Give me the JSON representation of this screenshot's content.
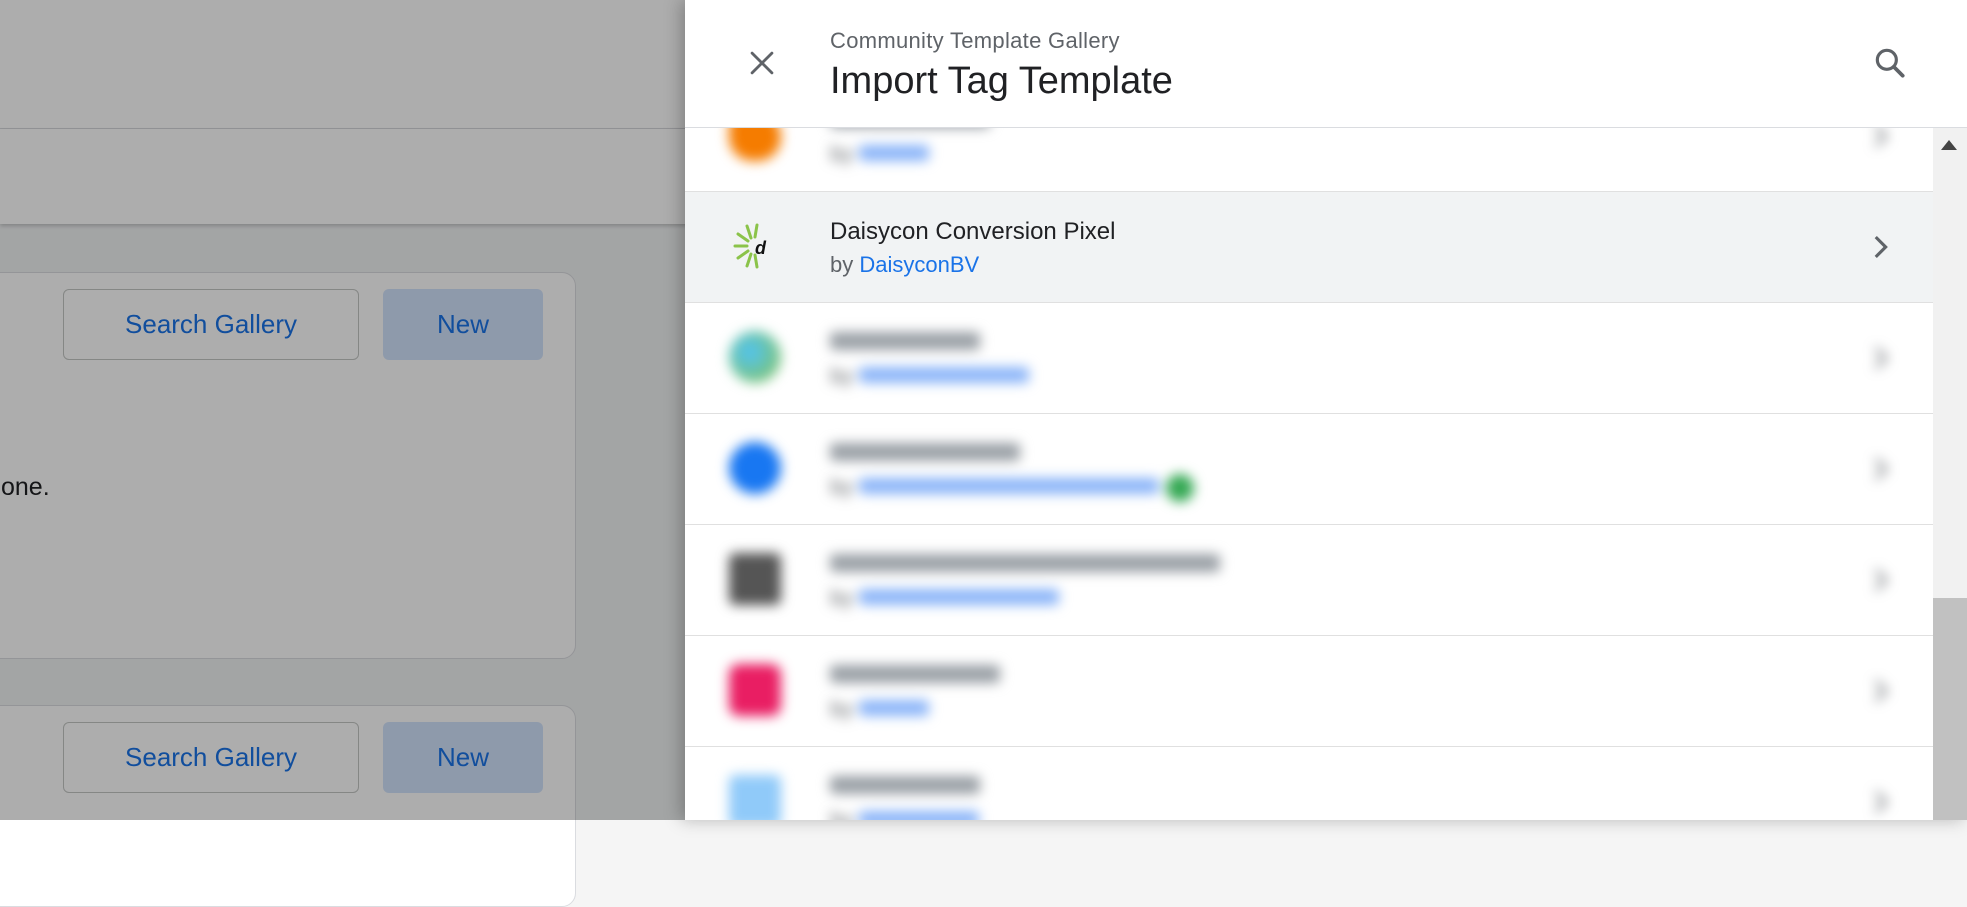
{
  "background": {
    "search_gallery_label": "Search Gallery",
    "new_label": "New",
    "description_fragment": "one."
  },
  "drawer": {
    "kicker": "Community Template Gallery",
    "title": "Import Tag Template",
    "close_icon": "close-icon",
    "search_icon": "search-icon"
  },
  "list": {
    "by_prefix": "by",
    "items": [
      {
        "name": "",
        "publisher": "",
        "logo_color": "#f57c00",
        "blurred": true
      },
      {
        "name": "Daisycon Conversion Pixel",
        "publisher": "DaisyconBV",
        "logo": "daisycon-logo",
        "blurred": false,
        "selected": true
      },
      {
        "name": "",
        "publisher": "",
        "logo_color": "#8bc34a",
        "blurred": true
      },
      {
        "name": "",
        "publisher": "",
        "logo_color": "#1877f2",
        "blurred": true
      },
      {
        "name": "",
        "publisher": "",
        "logo_color": "#555555",
        "blurred": true
      },
      {
        "name": "",
        "publisher": "",
        "logo_color": "#e91e63",
        "blurred": true
      },
      {
        "name": "",
        "publisher": "",
        "logo_color": "#90caf9",
        "blurred": true
      }
    ]
  },
  "colors": {
    "link": "#1a73e8",
    "selected_row": "#f1f3f4",
    "scrim": "rgba(0,0,0,0.32)"
  }
}
